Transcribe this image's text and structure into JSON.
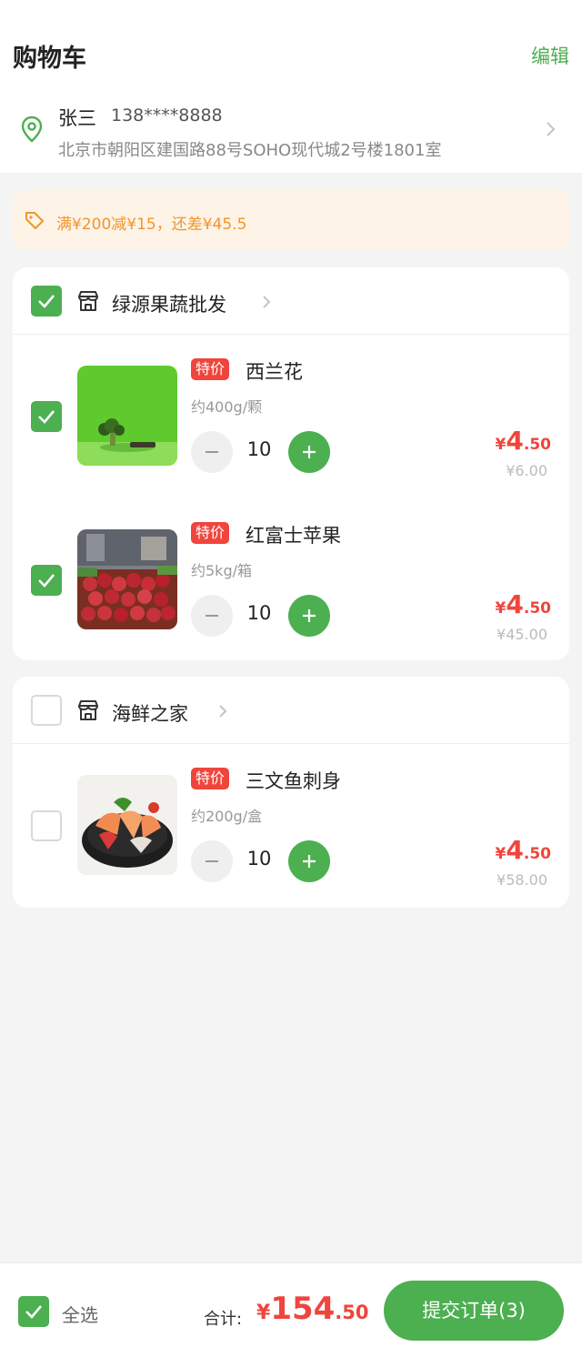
{
  "header": {
    "title": "购物车",
    "edit_label": "编辑"
  },
  "address": {
    "name": "张三",
    "phone": "138****8888",
    "detail": "北京市朝阳区建国路88号SOHO现代城2号楼1801室"
  },
  "promo": {
    "text": "满¥200减¥15，还差¥45.5"
  },
  "shops": [
    {
      "name": "绿源果蔬批发",
      "checked": true,
      "items": [
        {
          "tag": "特价",
          "name": "西兰花",
          "spec": "约400g/颗",
          "qty": "10",
          "currency": "¥",
          "price_int": "4",
          "price_dec": ".50",
          "orig_price": "¥6.00",
          "checked": true
        },
        {
          "tag": "特价",
          "name": "红富士苹果",
          "spec": "约5kg/箱",
          "qty": "10",
          "currency": "¥",
          "price_int": "4",
          "price_dec": ".50",
          "orig_price": "¥45.00",
          "checked": true
        }
      ]
    },
    {
      "name": "海鲜之家",
      "checked": false,
      "items": [
        {
          "tag": "特价",
          "name": "三文鱼刺身",
          "spec": "约200g/盒",
          "qty": "10",
          "currency": "¥",
          "price_int": "4",
          "price_dec": ".50",
          "orig_price": "¥58.00",
          "checked": false
        }
      ]
    }
  ],
  "footer": {
    "select_all_label": "全选",
    "select_all_checked": true,
    "total_label": "合计:",
    "total_currency": "¥",
    "total_int": "154",
    "total_dec": ".50",
    "submit_label": "提交订单(3)"
  },
  "colors": {
    "accent": "#4caf50",
    "price": "#f0453c",
    "promo_text": "#f0962e",
    "promo_bg": "#fdf3e7"
  },
  "icons": [
    "location-pin-icon",
    "chevron-right-icon",
    "coupon-tag-icon",
    "shop-icon",
    "check-icon",
    "minus-icon",
    "plus-icon"
  ]
}
